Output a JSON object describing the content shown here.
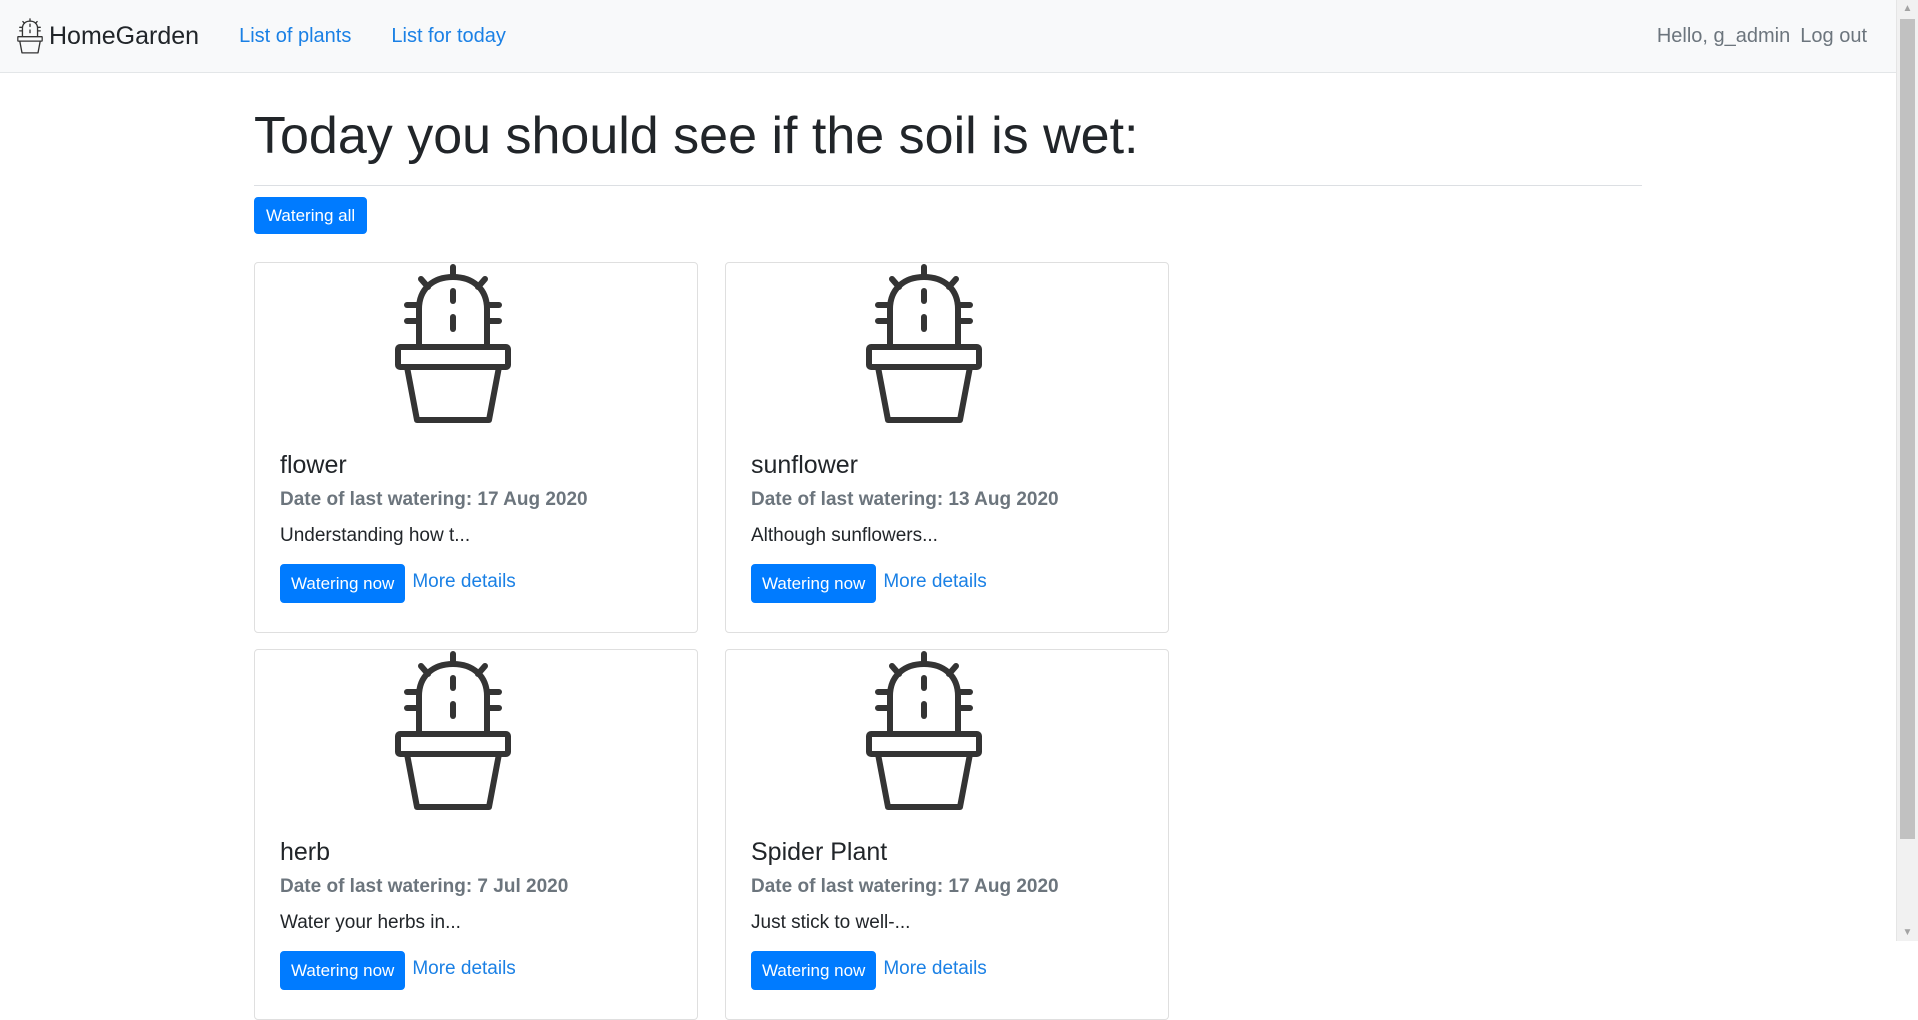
{
  "navbar": {
    "brand": "HomeGarden",
    "brand_icon": "cactus-icon",
    "links": [
      "List of plants",
      "List for today"
    ],
    "greeting": "Hello, g_admin",
    "logout": "Log out"
  },
  "main": {
    "title": "Today you should see if the soil is wet:",
    "water_all_label": "Watering all",
    "cards": [
      {
        "name": "flower",
        "last_watering": "Date of last watering: 17 Aug 2020",
        "description": "Understanding how t...",
        "water_label": "Watering now",
        "details_label": "More details",
        "icon": "cactus-icon"
      },
      {
        "name": "sunflower",
        "last_watering": "Date of last watering: 13 Aug 2020",
        "description": "Although sunflowers...",
        "water_label": "Watering now",
        "details_label": "More details",
        "icon": "cactus-icon"
      },
      {
        "name": "herb",
        "last_watering": "Date of last watering: 7 Jul 2020",
        "description": "Water your herbs in...",
        "water_label": "Watering now",
        "details_label": "More details",
        "icon": "cactus-icon"
      },
      {
        "name": "Spider Plant",
        "last_watering": "Date of last watering: 17 Aug 2020",
        "description": "Just stick to well-...",
        "water_label": "Watering now",
        "details_label": "More details",
        "icon": "cactus-icon"
      }
    ]
  },
  "colors": {
    "primary": "#007bff",
    "link": "#1a80e5",
    "muted": "#6c757d",
    "navbar_bg": "#f8f9fa",
    "icon": "#343434"
  }
}
